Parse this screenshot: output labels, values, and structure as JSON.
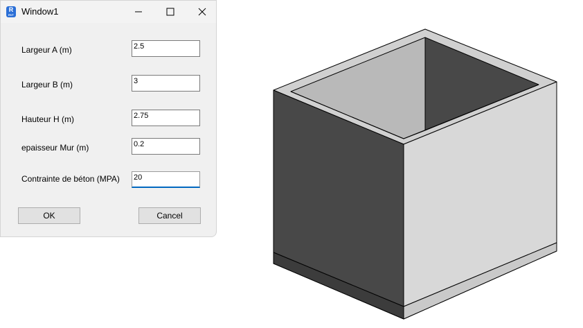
{
  "window": {
    "title": "Window1",
    "icon": "revit-app-icon",
    "icon_letter": "R",
    "icon_sub": "RVT",
    "controls": [
      "minimize-icon",
      "maximize-icon",
      "close-icon"
    ]
  },
  "form": {
    "fields": [
      {
        "label": "Largeur A (m)",
        "value": "2.5"
      },
      {
        "label": "Largeur B (m)",
        "value": "3"
      },
      {
        "label": "Hauteur H (m)",
        "value": "2.75"
      },
      {
        "label": "epaisseur Mur (m)",
        "value": "0.2"
      },
      {
        "label": "Contrainte de béton (MPA)",
        "value": "20"
      }
    ],
    "ok_label": "OK",
    "cancel_label": "Cancel"
  },
  "colors": {
    "accent": "#0067c0",
    "box_dark_face": "#484848",
    "box_light_face": "#d8d8d8",
    "box_inner": "#b9b9b9"
  }
}
